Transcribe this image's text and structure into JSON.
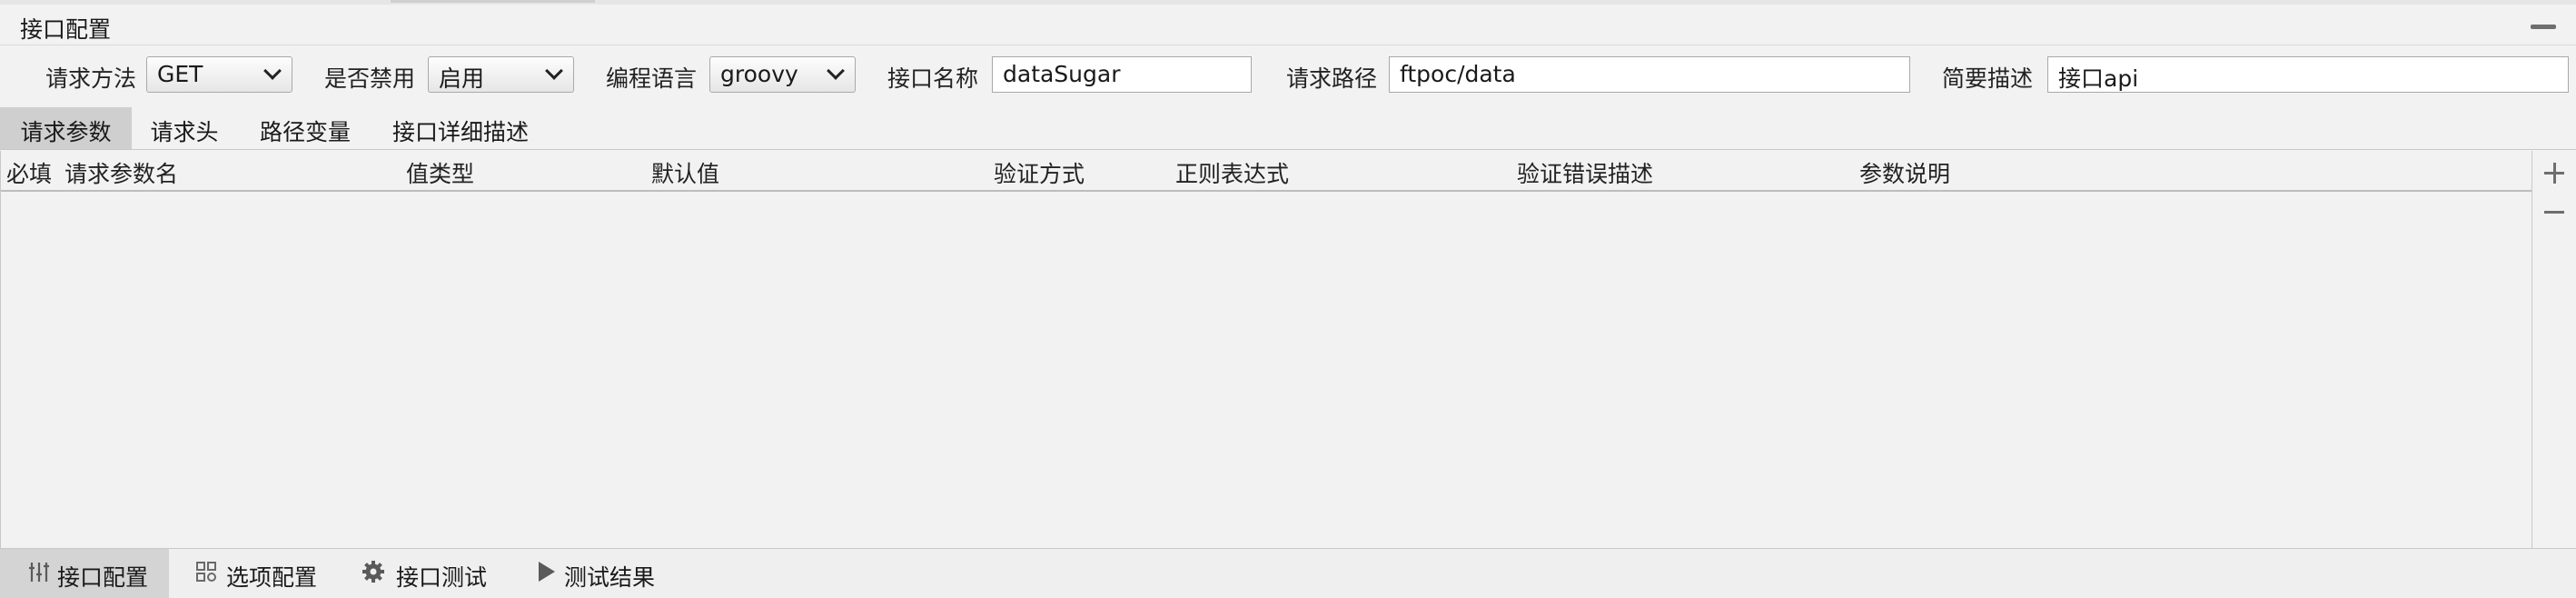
{
  "panel": {
    "title": "接口配置"
  },
  "config": {
    "method_label": "请求方法",
    "method_value": "GET",
    "disabled_label": "是否禁用",
    "disabled_value": "启用",
    "language_label": "编程语言",
    "language_value": "groovy",
    "name_label": "接口名称",
    "name_value": "dataSugar",
    "path_label": "请求路径",
    "path_value": "ftpoc/data",
    "desc_label": "简要描述",
    "desc_value": "接口api"
  },
  "tabs": [
    {
      "label": "请求参数",
      "active": true
    },
    {
      "label": "请求头",
      "active": false
    },
    {
      "label": "路径变量",
      "active": false
    },
    {
      "label": "接口详细描述",
      "active": false
    }
  ],
  "table": {
    "columns": [
      "必填",
      "请求参数名",
      "值类型",
      "默认值",
      "验证方式",
      "正则表达式",
      "验证错误描述",
      "参数说明"
    ],
    "rows": []
  },
  "bottom_tabs": [
    {
      "label": "接口配置",
      "icon": "sliders-icon",
      "active": true
    },
    {
      "label": "选项配置",
      "icon": "grid-icon",
      "active": false
    },
    {
      "label": "接口测试",
      "icon": "gear-icon",
      "active": false
    },
    {
      "label": "测试结果",
      "icon": "play-icon",
      "active": false
    }
  ]
}
